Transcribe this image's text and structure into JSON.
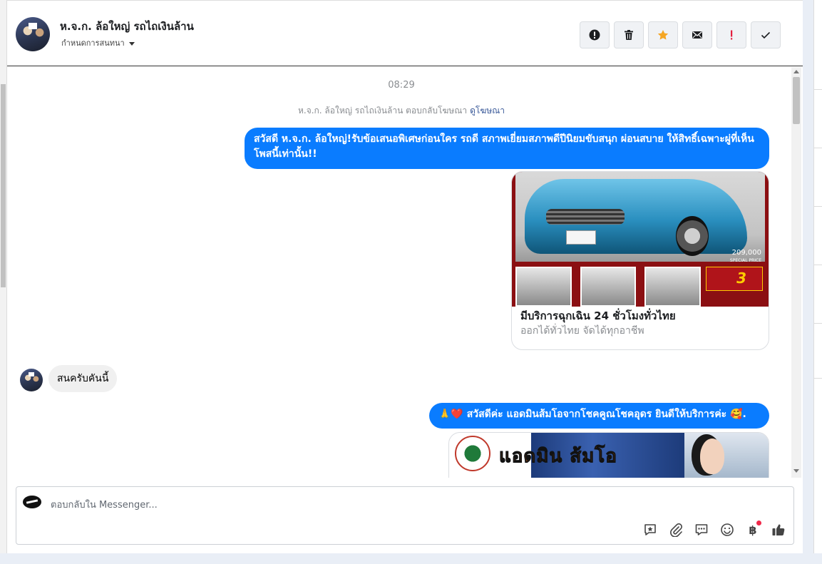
{
  "header": {
    "contact_name": "ห.จ.ก. ล้อใหญ่ รถไถเงินล้าน",
    "assign_label": "กำหนดการสนทนา",
    "actions": [
      {
        "icon": "alert-circle-icon",
        "label": "!"
      },
      {
        "icon": "trash-icon",
        "label": ""
      },
      {
        "icon": "star-icon",
        "label": ""
      },
      {
        "icon": "envelope-icon",
        "label": ""
      },
      {
        "icon": "exclamation-icon",
        "label": "!"
      },
      {
        "icon": "checkmark-icon",
        "label": ""
      }
    ]
  },
  "conversation": {
    "timestamp": "08:29",
    "replied_text": "ห.จ.ก. ล้อใหญ่ รถไถเงินล้าน ตอบกลับโฆษณา",
    "replied_link": "ดูโฆษณา",
    "message_1": "สวัสดี ห.จ.ก.   ล้อใหญ่!รับข้อเสนอพิเศษก่อนใคร รถดี สภาพเยี่ยมสภาพดีปีนิยมขับสนุก ผ่อนสบาย ให้สิทธิ์เฉพาะผู่ที่เห็นโพสนี้เท่านั้น!!",
    "ad_card": {
      "price": "209,000",
      "price_caption": "SPECIAL PRICE",
      "promo_number": "3",
      "title": "มีบริการฉุกเฉิน 24 ชั่วโมงทั่วไทย",
      "subtitle": "ออกได้ทั่วไทย จัดได้ทุกอาชีพ"
    },
    "incoming_message": "สนครับคันนี้",
    "message_2": "🙏❤️ สวัสดีค่ะ แอดมินส้มโอจากโชคคูณโชคอุดร ยินดีให้บริการค่ะ 🥰.",
    "banner_text": "แอดมิน ส้มโอ"
  },
  "composer": {
    "placeholder": "ตอบกลับใน Messenger...",
    "tools": [
      "saved-reply-icon",
      "attachment-icon",
      "chat-bubbles-icon",
      "emoji-icon",
      "baht-payment-icon",
      "thumbs-up-icon"
    ],
    "baht_symbol": "฿"
  },
  "colors": {
    "accent": "#0a7cff",
    "star": "#f5a623",
    "alert": "#e41e3f"
  }
}
